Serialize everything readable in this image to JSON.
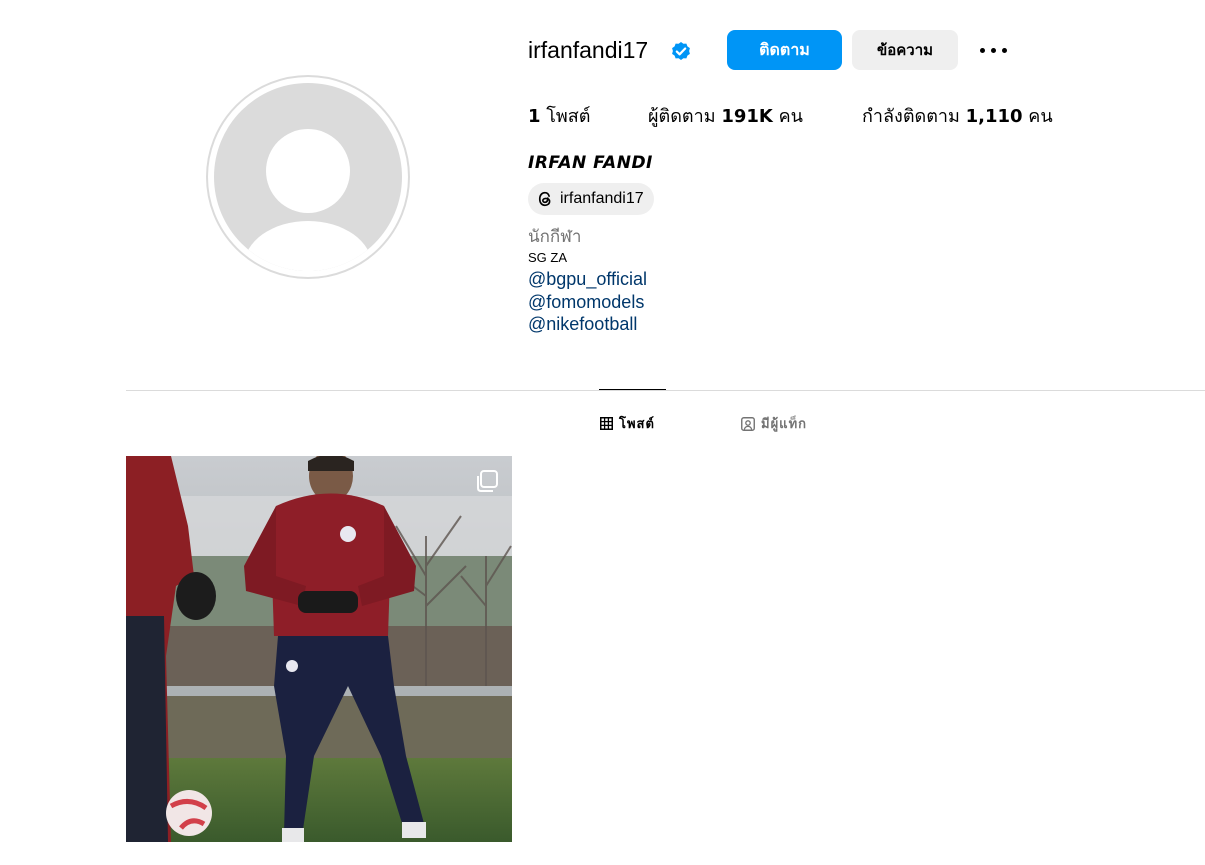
{
  "profile": {
    "username": "irfanfandi17",
    "full_name": "IRFAN FANDI",
    "threads_handle": "irfanfandi17",
    "category": "นักกีฬา",
    "bio_line": "SG ZA",
    "mentions": [
      "@bgpu_official",
      "@fomomodels",
      "@nikefootball"
    ]
  },
  "actions": {
    "follow_label": "ติดตาม",
    "message_label": "ข้อความ"
  },
  "stats": {
    "posts_count": "1",
    "posts_label": "โพสต์",
    "followers_prefix": "ผู้ติดตาม",
    "followers_count": "191K",
    "followers_suffix": "คน",
    "following_prefix": "กำลังติดตาม",
    "following_count": "1,110",
    "following_suffix": "คน"
  },
  "tabs": {
    "posts_label": "โพสต์",
    "tagged_label": "มีผู้แท็ก"
  },
  "colors": {
    "accent": "#0095f6",
    "link": "#00376b",
    "muted": "#737373",
    "chip_bg": "#efefef",
    "divider": "#dbdbdb"
  }
}
